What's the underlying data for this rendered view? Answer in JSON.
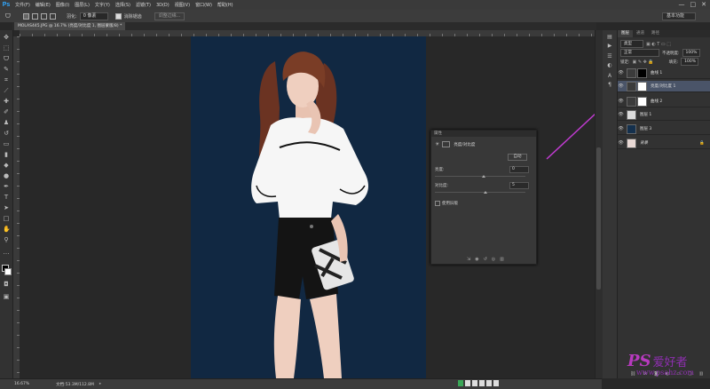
{
  "app": {
    "logo": "Ps"
  },
  "menu": [
    "文件(F)",
    "编辑(E)",
    "图像(I)",
    "图层(L)",
    "文字(Y)",
    "选择(S)",
    "滤镜(T)",
    "3D(D)",
    "视图(V)",
    "窗口(W)",
    "帮助(H)"
  ],
  "window_controls": [
    "—",
    "□",
    "✕"
  ],
  "options": {
    "feather_label": "羽化:",
    "feather_value": "0 像素",
    "antialias_label": "消除锯齿",
    "refine_edge": "调整边缘...",
    "workspace": "基本功能"
  },
  "document_tab": "MOLAS445.JPG @ 16.7% (亮度/对比度 1, 图层蒙版/8) *",
  "status": {
    "zoom": "16.67%",
    "doc_info": "文档:53.3M/112.8M"
  },
  "properties": {
    "title": "属性",
    "panel_name": "亮度/对比度",
    "auto_label": "自动",
    "brightness_label": "亮度:",
    "brightness_value": "0",
    "contrast_label": "对比度:",
    "contrast_value": "5",
    "legacy_label": "使用旧版"
  },
  "layers_panel": {
    "tabs": [
      "图层",
      "通道",
      "路径"
    ],
    "filter_kind": "类型",
    "blend_mode": "正常",
    "opacity_label": "不透明度:",
    "opacity_value": "100%",
    "lock_label": "锁定:",
    "fill_label": "填充:",
    "fill_value": "100%",
    "layers": [
      {
        "name": "曲线 1",
        "visible": true,
        "selected": false
      },
      {
        "name": "亮度/对比度 1",
        "visible": true,
        "selected": true
      },
      {
        "name": "曲线 2",
        "visible": true,
        "selected": false
      },
      {
        "name": "图层 1",
        "visible": true,
        "selected": false
      },
      {
        "name": "图层 3",
        "visible": true,
        "selected": false
      },
      {
        "name": "背景",
        "visible": true,
        "selected": false
      }
    ]
  },
  "watermark": {
    "ps": "PS",
    "cn": "爱好者",
    "url": "www.psahz.com"
  }
}
